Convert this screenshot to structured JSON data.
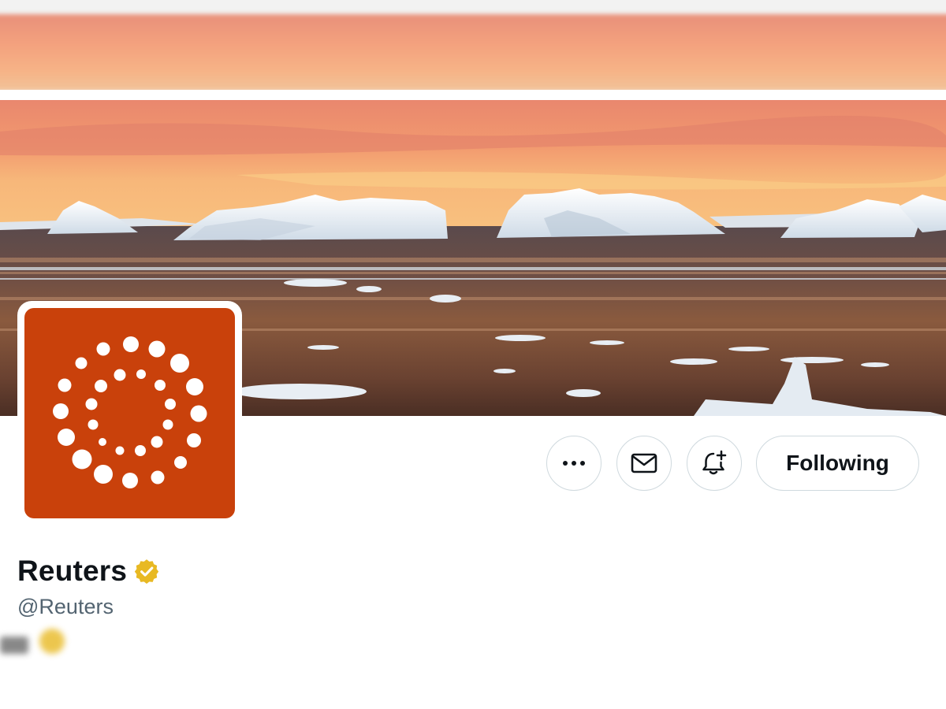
{
  "profile": {
    "display_name": "Reuters",
    "handle": "@Reuters",
    "verified_badge_color": "#e8b923",
    "logo_background": "#c9410b"
  },
  "actions": {
    "more_icon": "more-horizontal-icon",
    "message_icon": "mail-icon",
    "notify_icon": "bell-plus-icon",
    "following_label": "Following"
  },
  "colors": {
    "border": "#cfd9de",
    "text_primary": "#0f1419",
    "text_secondary": "#536471"
  }
}
